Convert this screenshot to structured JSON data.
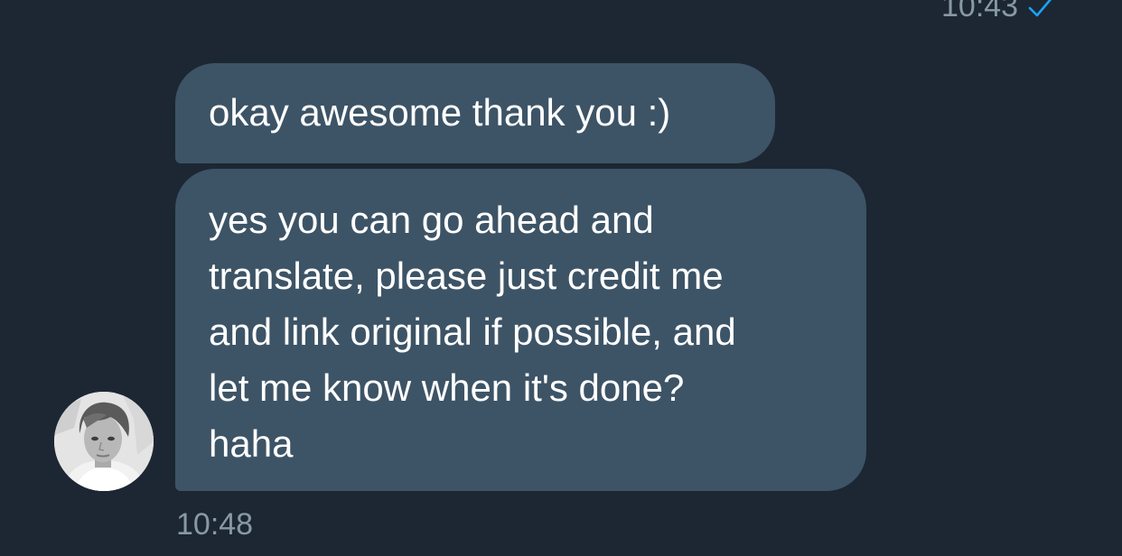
{
  "conversation": {
    "previous_sent_time": "10:43",
    "read_indicator_icon": "check-icon",
    "messages": [
      {
        "sender": "received",
        "lines": [
          "okay awesome thank you :)"
        ]
      },
      {
        "sender": "received",
        "lines": [
          "yes you can go ahead and",
          "translate, please just credit me",
          "and link original if possible, and",
          "let me know when it's done?",
          "haha"
        ]
      }
    ],
    "received_time": "10:48",
    "avatar_icon": "avatar-photo"
  },
  "colors": {
    "background": "#1c2733",
    "bubble": "#3d5466",
    "timestamp": "#8899a6",
    "check": "#1da1f2",
    "text": "#ffffff"
  }
}
